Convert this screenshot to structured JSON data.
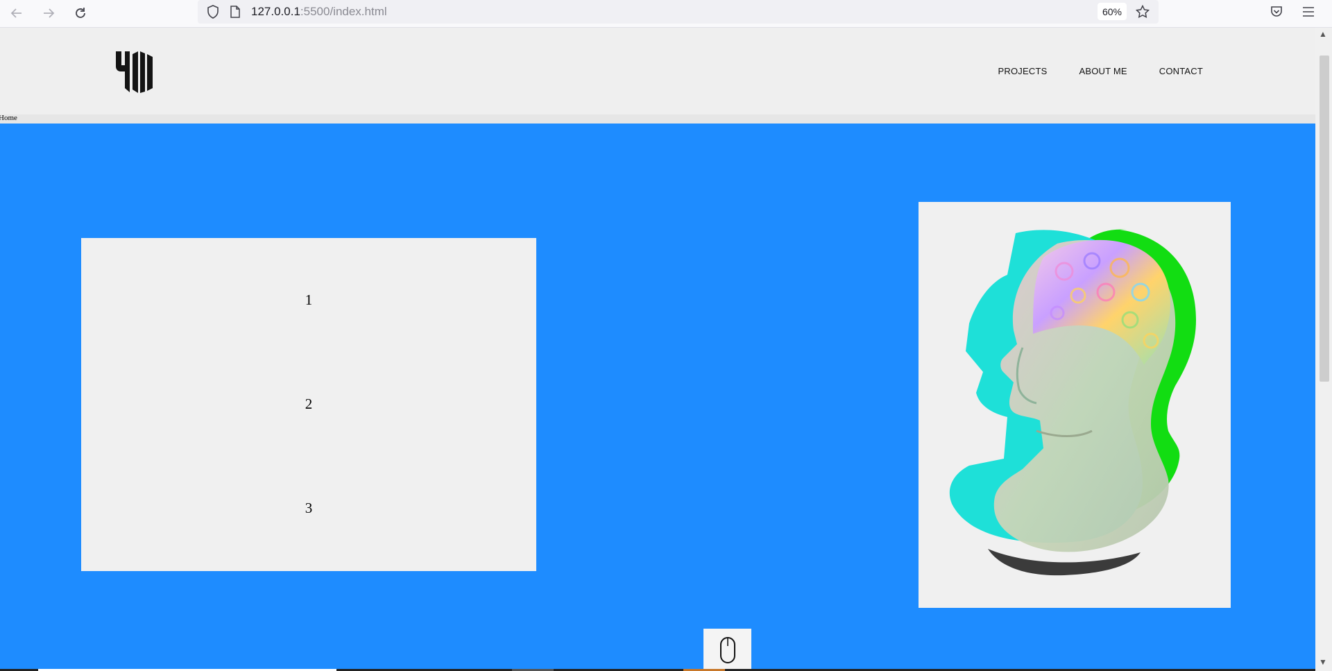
{
  "browser": {
    "url_host": "127.0.0.1",
    "url_path": ":5500/index.html",
    "zoom": "60%",
    "icons": [
      "back-arrow-icon",
      "forward-arrow-icon",
      "reload-icon",
      "shield-icon",
      "page-icon",
      "star-icon",
      "pocket-icon",
      "menu-icon"
    ]
  },
  "site": {
    "logo_text": "YM",
    "nav": {
      "projects": "PROJECTS",
      "about": "ABOUT ME",
      "contact": "CONTACT"
    },
    "breadcrumb": "Home"
  },
  "main": {
    "panel_items": [
      "1",
      "2",
      "3"
    ],
    "image_description_icon": "glitch-bust-image",
    "scroll_icon": "mouse-icon"
  },
  "colors": {
    "background": "#1e8cff",
    "header": "#efefef",
    "panel": "#f0f0f0"
  }
}
